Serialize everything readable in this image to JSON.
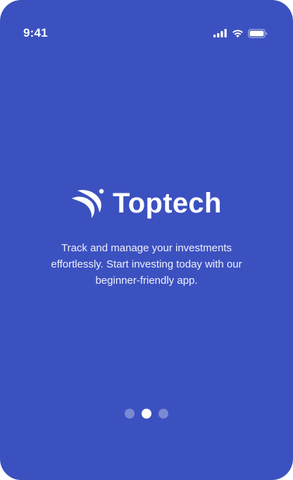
{
  "status_bar": {
    "time": "9:41",
    "icons": [
      "cellular-signal-icon",
      "wifi-icon",
      "battery-icon"
    ]
  },
  "brand": {
    "name": "Toptech",
    "logo_icon": "toptech-logo-icon"
  },
  "tagline": {
    "line1": "Track and manage your investments",
    "line2": "effortlessly. Start investing today with our",
    "line3": "beginner-friendly app."
  },
  "pager": {
    "total": 3,
    "active_index": 1
  },
  "colors": {
    "background": "#3c51c0",
    "text": "#ffffff",
    "dot_inactive": "rgba(255,255,255,0.32)",
    "dot_active": "#ffffff"
  }
}
